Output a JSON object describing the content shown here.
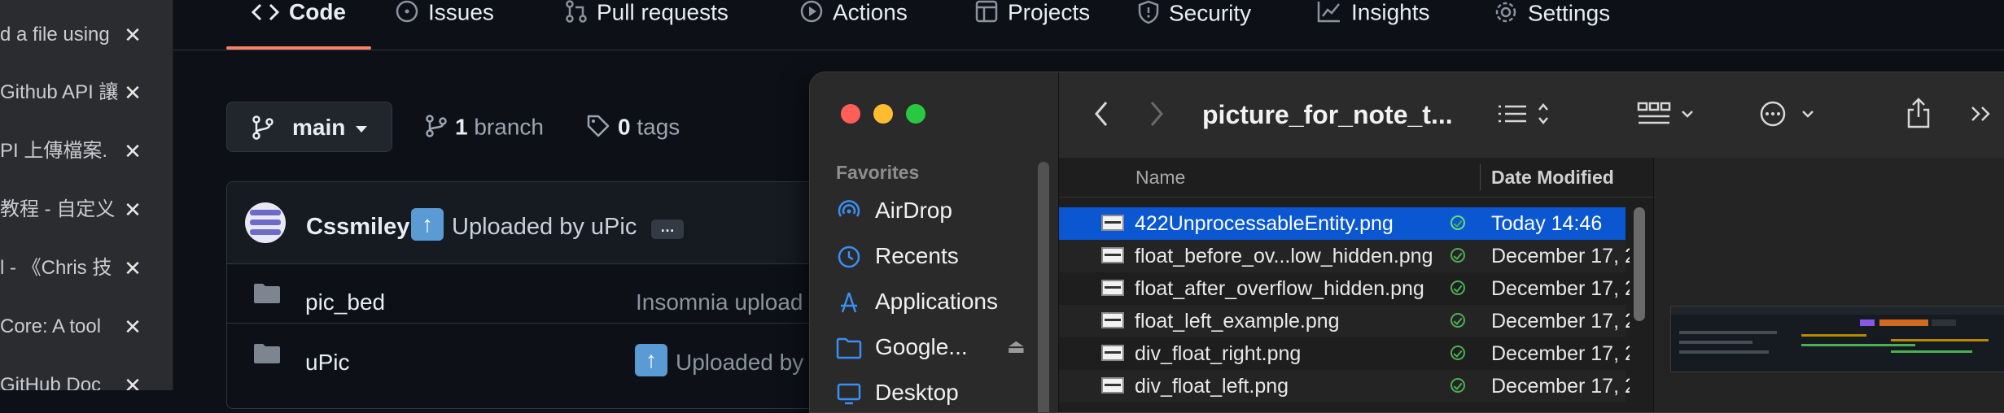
{
  "tabs": [
    {
      "title": "d a file using"
    },
    {
      "title": "Github API 讓"
    },
    {
      "title": "PI 上傳檔案."
    },
    {
      "title": "教程 - 自定义"
    },
    {
      "title": "l - 《Chris 技"
    },
    {
      "title": "Core: A tool"
    },
    {
      "title": "GitHub Doc"
    }
  ],
  "tab_close_glyph": "✕",
  "repo_nav": {
    "code": "Code",
    "issues": "Issues",
    "pull_requests": "Pull requests",
    "actions": "Actions",
    "projects": "Projects",
    "security": "Security",
    "insights": "Insights",
    "settings": "Settings"
  },
  "branch": {
    "current": "main"
  },
  "branch_count": {
    "count": "1",
    "label": "branch"
  },
  "tag_count": {
    "count": "0",
    "label": "tags"
  },
  "commit": {
    "author": "Cssmiley",
    "emoji": "⬆️",
    "message": "Uploaded by uPic",
    "ellipsis": "…"
  },
  "files": [
    {
      "name": "pic_bed",
      "message": "Insomnia upload"
    },
    {
      "name": "uPic",
      "message": "Uploaded by"
    }
  ],
  "finder": {
    "title": "picture_for_note_t...",
    "sidebar_section": "Favorites",
    "sidebar_items": [
      "AirDrop",
      "Recents",
      "Applications",
      "Google...",
      "Desktop"
    ],
    "columns": {
      "name": "Name",
      "date": "Date Modified"
    },
    "rows": [
      {
        "name": "422UnprocessableEntity.png",
        "date": "Today 14:46"
      },
      {
        "name": "float_before_ov...low_hidden.png",
        "date": "December 17, 2"
      },
      {
        "name": "float_after_overflow_hidden.png",
        "date": "December 17, 2"
      },
      {
        "name": "float_left_example.png",
        "date": "December 17, 2"
      },
      {
        "name": "div_float_right.png",
        "date": "December 17, 2"
      },
      {
        "name": "div_float_left.png",
        "date": "December 17, 2"
      }
    ]
  },
  "colors": {
    "bg": "#0d1117",
    "accent_underline": "#f78166",
    "finder_selection": "#0a57d1",
    "close_red": "#ff5f57",
    "minimize_yellow": "#febc2e",
    "zoom_green": "#28c840"
  },
  "icons": {
    "tab_close": "close-icon",
    "code": "code-icon",
    "issues": "issue-circle-icon",
    "pull_requests": "pull-request-icon",
    "actions": "play-circle-icon",
    "projects": "table-icon",
    "security": "shield-icon",
    "insights": "graph-icon",
    "settings": "gear-icon",
    "branch": "git-branch-icon",
    "tag": "tag-icon",
    "folder": "folder-icon",
    "airdrop": "airdrop-icon",
    "recents": "clock-icon",
    "applications": "apps-icon",
    "google_drive": "drive-folder-icon",
    "eject": "eject-icon"
  }
}
